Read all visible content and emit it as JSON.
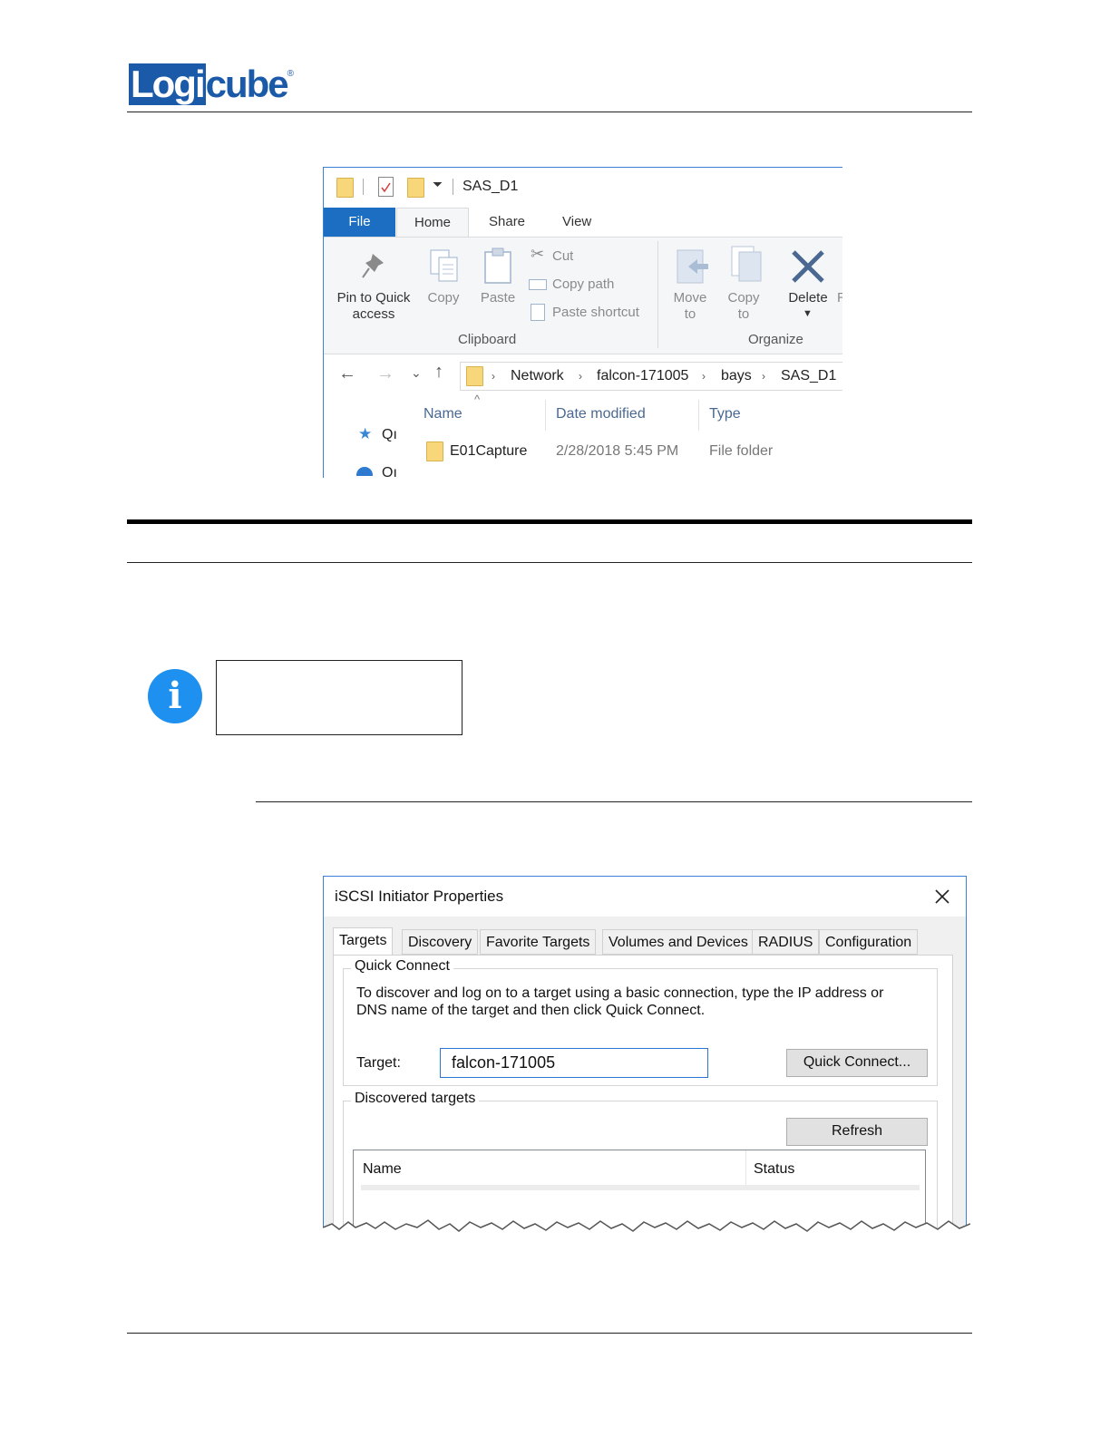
{
  "logo": {
    "box": "Logi",
    "rest": "cube",
    "reg": "®"
  },
  "explorer": {
    "window_title": "SAS_D1",
    "tabs": {
      "file": "File",
      "home": "Home",
      "share": "Share",
      "view": "View"
    },
    "ribbon": {
      "pin_line1": "Pin to Quick",
      "pin_line2": "access",
      "copy": "Copy",
      "paste": "Paste",
      "cut": "Cut",
      "copy_path": "Copy path",
      "paste_shortcut": "Paste shortcut",
      "move_line1": "Move",
      "move_line2": "to",
      "copyto_line1": "Copy",
      "copyto_line2": "to",
      "delete": "Delete",
      "clipboard_group": "Clipboard",
      "organize_group": "Organize",
      "partial_next": "R"
    },
    "breadcrumbs": [
      "Network",
      "falcon-171005",
      "bays",
      "SAS_D1"
    ],
    "nav_partial": [
      "Qı",
      "Oı"
    ],
    "columns": {
      "name": "Name",
      "date": "Date modified",
      "type": "Type"
    },
    "row": {
      "name": "E01Capture",
      "date": "2/28/2018 5:45 PM",
      "type": "File folder"
    }
  },
  "info": {
    "icon_glyph": "i"
  },
  "iscsi": {
    "title": "iSCSI Initiator Properties",
    "tabs": [
      "Targets",
      "Discovery",
      "Favorite Targets",
      "Volumes and Devices",
      "RADIUS",
      "Configuration"
    ],
    "quick_connect": {
      "legend": "Quick Connect",
      "desc_line1": "To discover and log on to a target using a basic connection, type the IP address or",
      "desc_line2": "DNS name of the target and then click Quick Connect.",
      "target_label": "Target:",
      "target_value": "falcon-171005",
      "button": "Quick Connect..."
    },
    "discovered": {
      "legend": "Discovered targets",
      "refresh": "Refresh",
      "col_name": "Name",
      "col_status": "Status"
    }
  }
}
